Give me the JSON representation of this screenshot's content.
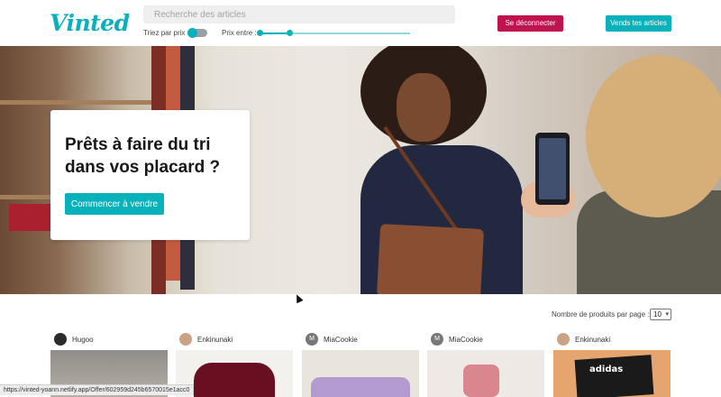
{
  "header": {
    "logo": "Vinted",
    "search_placeholder": "Recherche des articles",
    "sort_label": "Triez par prix :",
    "price_label": "Prix entre :",
    "price_range": {
      "low_fraction": 0.0,
      "high_fraction": 0.2
    },
    "logout_label": "Se déconnecter",
    "sell_label": "Vends tes articles"
  },
  "hero": {
    "title": "Prêts à faire du tri dans vos placard ?",
    "cta_label": "Commencer à vendre"
  },
  "listing": {
    "per_page_label": "Nombre de produits par page :",
    "per_page_value": "10",
    "products": [
      {
        "username": "Hugoo",
        "avatar": "photo",
        "thumb": "wood"
      },
      {
        "username": "Enkinunaki",
        "avatar": "photo",
        "thumb": "maroon-sweater"
      },
      {
        "username": "MiaCookie",
        "avatar": "M",
        "thumb": "lilac-top"
      },
      {
        "username": "MiaCookie",
        "avatar": "M",
        "thumb": "pink-shoes"
      },
      {
        "username": "Enkinunaki",
        "avatar": "photo",
        "thumb": "adidas-box"
      }
    ]
  },
  "status_bar": {
    "url": "https://vinted-yoann.netlify.app/Offer/602959d245b6570015e1acc0"
  },
  "colors": {
    "brand": "#09b1ba",
    "logout": "#c0124f"
  }
}
